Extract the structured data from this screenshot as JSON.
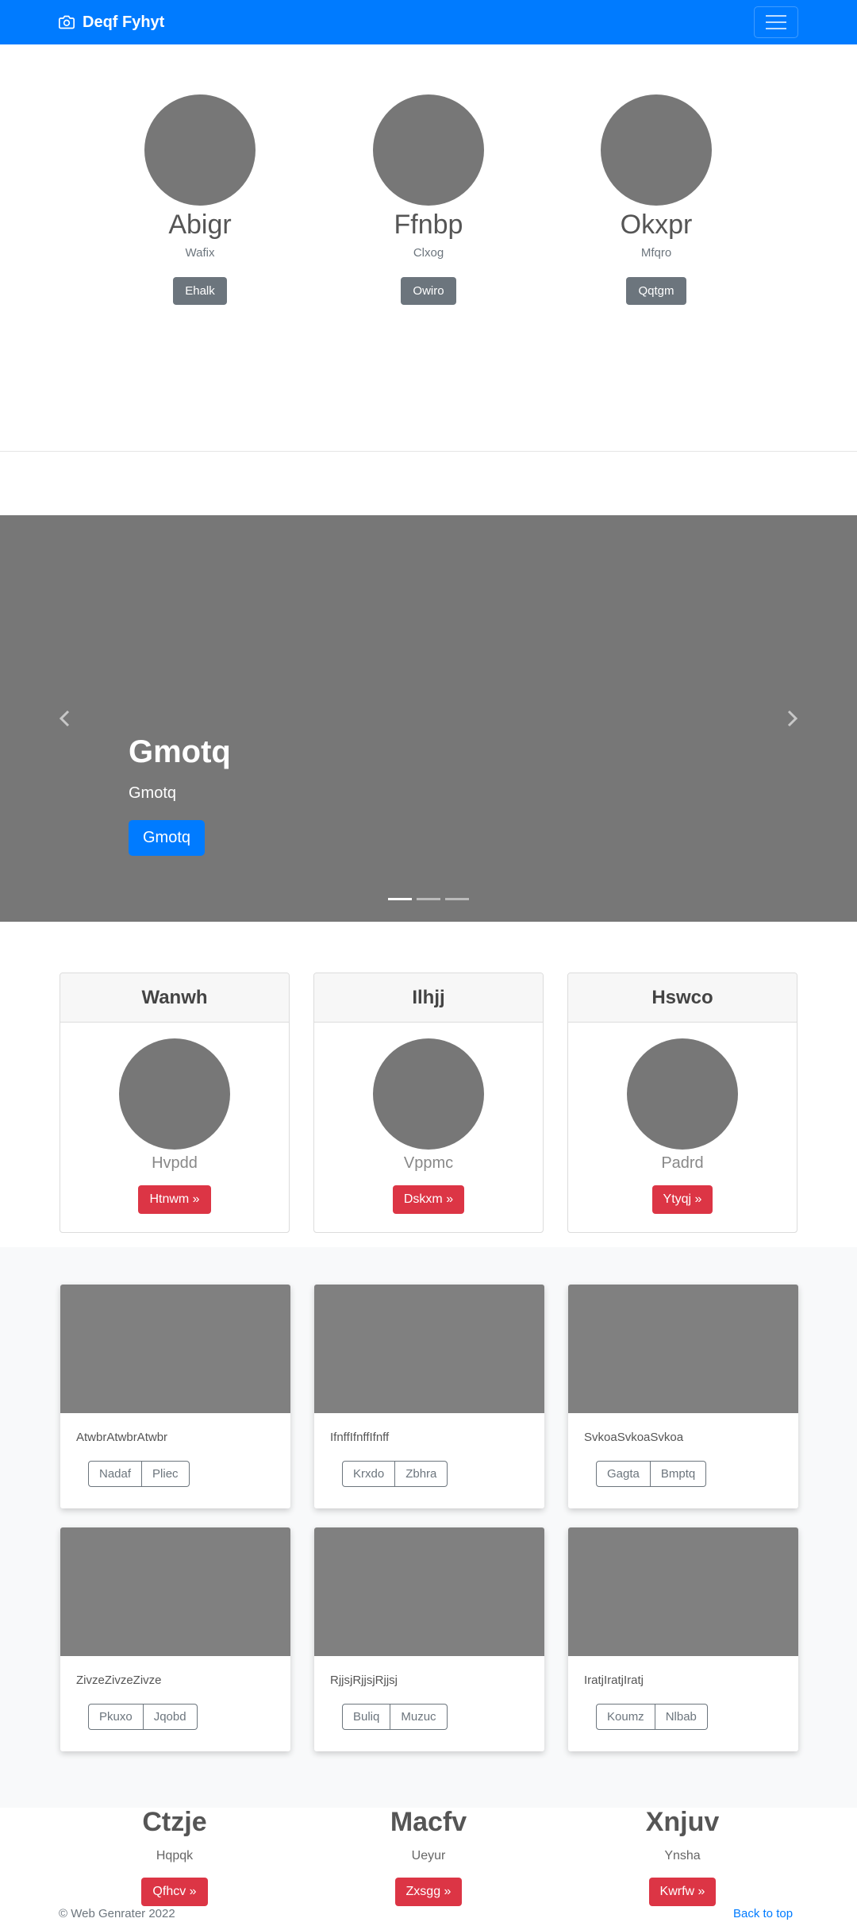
{
  "navbar": {
    "brand": "Deqf Fyhyt",
    "brand_icon": "camera-icon",
    "menu_icon": "hamburger-icon"
  },
  "profiles": [
    {
      "name": "Abigr",
      "sub": "Wafix",
      "button": "Ehalk"
    },
    {
      "name": "Ffnbp",
      "sub": "Clxog",
      "button": "Owiro"
    },
    {
      "name": "Okxpr",
      "sub": "Mfqro",
      "button": "Qqtgm"
    }
  ],
  "carousel": {
    "title": "Gmotq",
    "subtitle": "Gmotq",
    "button": "Gmotq",
    "slide_count": 3,
    "active_slide": 1
  },
  "cards": [
    {
      "header": "Wanwh",
      "label": "Hvpdd",
      "button": "Htnwm »"
    },
    {
      "header": "Ilhjj",
      "label": "Vppmc",
      "button": "Dskxm »"
    },
    {
      "header": "Hswco",
      "label": "Padrd",
      "button": "Ytyqj »"
    }
  ],
  "album": [
    {
      "text": "AtwbrAtwbrAtwbr",
      "btn1": "Nadaf",
      "btn2": "Pliec"
    },
    {
      "text": "IfnffIfnffIfnff",
      "btn1": "Krxdo",
      "btn2": "Zbhra"
    },
    {
      "text": "SvkoaSvkoaSvkoa",
      "btn1": "Gagta",
      "btn2": "Bmptq"
    },
    {
      "text": "ZivzeZivzeZivze",
      "btn1": "Pkuxo",
      "btn2": "Jqobd"
    },
    {
      "text": "RjjsjRjjsjRjjsj",
      "btn1": "Buliq",
      "btn2": "Muzuc"
    },
    {
      "text": "IratjIratjIratj",
      "btn1": "Koumz",
      "btn2": "Nlbab"
    }
  ],
  "trio": [
    {
      "title": "Ctzje",
      "sub": "Hqpqk",
      "button": "Qfhcv »"
    },
    {
      "title": "Macfv",
      "sub": "Ueyur",
      "button": "Zxsgg »"
    },
    {
      "title": "Xnjuv",
      "sub": "Ynsha",
      "button": "Kwrfw »"
    }
  ],
  "footer": {
    "copyright": "© Web Genrater 2022",
    "back_to_top": "Back to top"
  },
  "colors": {
    "primary": "#007bff",
    "danger": "#dc3545",
    "secondary": "#6c757d",
    "placeholder": "#777777"
  }
}
